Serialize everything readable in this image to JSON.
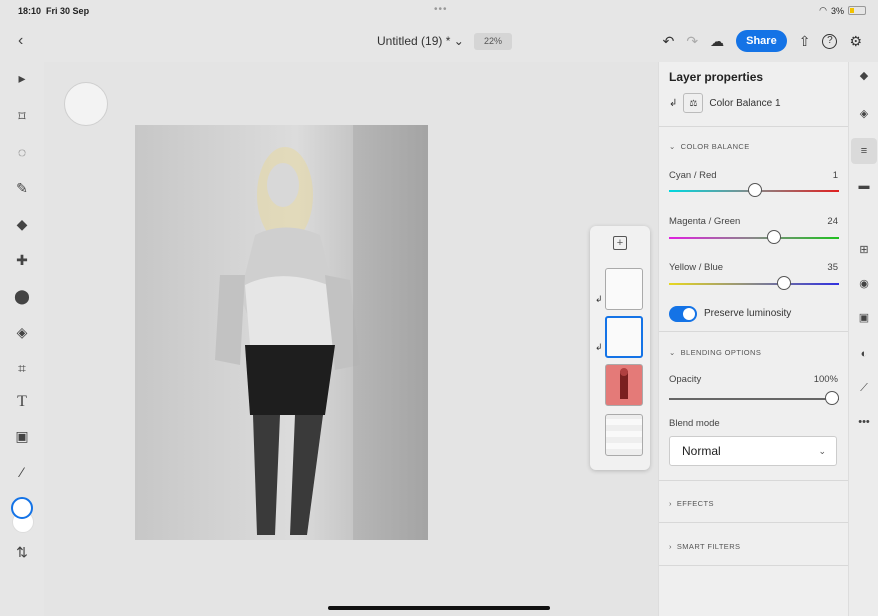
{
  "status": {
    "time": "18:10",
    "date": "Fri 30 Sep",
    "battery": "3%"
  },
  "topbar": {
    "title": "Untitled (19) *",
    "title_chevron": "⌄",
    "zoom": "22%",
    "share": "Share"
  },
  "icons": {
    "back": "‹",
    "undo": "↶",
    "redo": "↷",
    "cloud": "☁",
    "export": "⇧",
    "help": "?",
    "settings": "⚙",
    "add_layer": "+",
    "clip": "↲"
  },
  "left_tools": [
    {
      "name": "select-tool",
      "glyph": "▸"
    },
    {
      "name": "transform-tool",
      "glyph": "⌑"
    },
    {
      "name": "lasso-tool",
      "glyph": "◌"
    },
    {
      "name": "brush-tool",
      "glyph": "✎"
    },
    {
      "name": "eraser-tool",
      "glyph": "◆"
    },
    {
      "name": "healing-tool",
      "glyph": "✚"
    },
    {
      "name": "clone-tool",
      "glyph": "⬤"
    },
    {
      "name": "fill-tool",
      "glyph": "◈"
    },
    {
      "name": "crop-tool",
      "glyph": "⌗"
    },
    {
      "name": "text-tool",
      "glyph": "T"
    },
    {
      "name": "place-image-tool",
      "glyph": "▣"
    },
    {
      "name": "eyedropper-tool",
      "glyph": "⁄"
    }
  ],
  "swap_glyph": "⇅",
  "properties": {
    "title": "Layer properties",
    "layer_name": "Color Balance 1",
    "color_balance": {
      "header": "COLOR BALANCE",
      "sliders": [
        {
          "label": "Cyan / Red",
          "value": "1",
          "pos": 0.505,
          "from": "#00d8e0",
          "to": "#e02020"
        },
        {
          "label": "Magenta / Green",
          "value": "24",
          "pos": 0.62,
          "from": "#e020e0",
          "to": "#20c020"
        },
        {
          "label": "Yellow / Blue",
          "value": "35",
          "pos": 0.675,
          "from": "#e8d820",
          "to": "#3030e0"
        }
      ],
      "preserve_label": "Preserve luminosity"
    },
    "blending": {
      "header": "BLENDING OPTIONS",
      "opacity_label": "Opacity",
      "opacity_value": "100%",
      "blend_mode_label": "Blend mode",
      "blend_mode": "Normal"
    },
    "effects": "EFFECTS",
    "smart_filters": "SMART FILTERS"
  },
  "accent": "#1473e6"
}
